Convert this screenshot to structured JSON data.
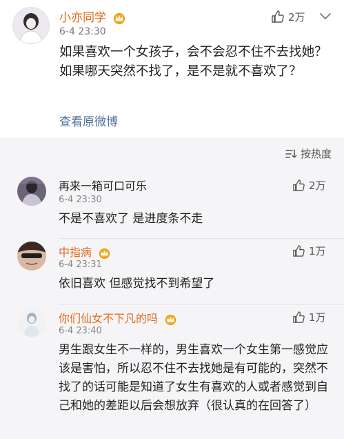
{
  "post": {
    "author": "小亦同学",
    "time": "6-4 23:30",
    "likes": "2万",
    "content": "如果喜欢一个女孩子，会不会忍不住不去找她？如果哪天突然不找了，是不是就不喜欢了？",
    "view_original": "查看原微博"
  },
  "sort": {
    "label": "按热度"
  },
  "comments": [
    {
      "author": "再来一箱可口可乐",
      "time": "6-4 23:30",
      "likes": "2万",
      "text": "不是不喜欢了 是进度条不走"
    },
    {
      "author": "中指病",
      "time": "6-4 23:31",
      "likes": "1万",
      "text": "依旧喜欢 但感觉找不到希望了"
    },
    {
      "author": "你们仙女不下凡的吗",
      "time": "6-4 23:40",
      "likes": "1万",
      "text": "男生跟女生不一样的，男生喜欢一个女生第一感觉应该是害怕，所以忍不住不去找她是有可能的，突然不找了的话可能是知道了女生有喜欢的人或者感觉到自己和她的差距以后会想放弃（很认真的在回答了）"
    }
  ],
  "colors": {
    "vip_name": "#e06a1a",
    "link": "#4f6f96",
    "comments_background": "#f5f5f7"
  },
  "icons": {
    "like": "thumbs-up-icon",
    "more": "chevron-down-icon",
    "sort": "sort-icon",
    "vip": "crown-badge-icon"
  }
}
